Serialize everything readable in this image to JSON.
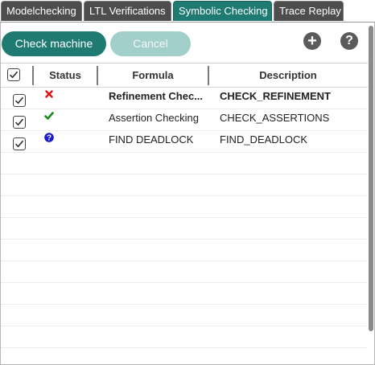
{
  "tabs": [
    {
      "label": "Modelchecking",
      "active": false
    },
    {
      "label": "LTL Verifications",
      "active": false
    },
    {
      "label": "Symbolic Checking",
      "active": true
    },
    {
      "label": "Trace Replay",
      "active": false
    }
  ],
  "toolbar": {
    "check_label": "Check machine",
    "cancel_label": "Cancel",
    "add_icon": "plus-circle-icon",
    "help_icon": "question-circle-icon"
  },
  "table": {
    "header_checked": true,
    "columns": {
      "status": "Status",
      "formula": "Formula",
      "description": "Description"
    },
    "rows": [
      {
        "checked": true,
        "status": "error",
        "status_icon": "cross-icon",
        "status_color": "#e01010",
        "formula": "Refinement Chec...",
        "description": "CHECK_REFINEMENT",
        "bold": true
      },
      {
        "checked": true,
        "status": "success",
        "status_icon": "check-icon",
        "status_color": "#1a8a1a",
        "formula": "Assertion Checking",
        "description": "CHECK_ASSERTIONS",
        "bold": false
      },
      {
        "checked": true,
        "status": "unknown",
        "status_icon": "question-icon",
        "status_color": "#1a1ad0",
        "formula": "FIND DEADLOCK",
        "description": "FIND_DEADLOCK",
        "bold": false
      }
    ]
  },
  "colors": {
    "accent": "#1f7a72",
    "accent_disabled": "#a2cfca",
    "tab_inactive": "#4d4d4d"
  }
}
